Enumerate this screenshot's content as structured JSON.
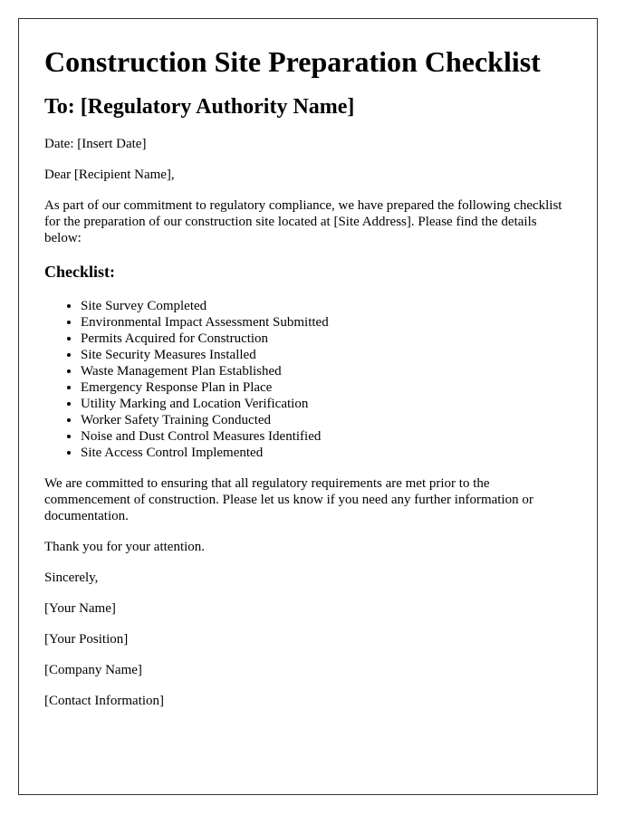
{
  "document": {
    "title": "Construction Site Preparation Checklist",
    "recipient_heading": "To: [Regulatory Authority Name]",
    "date_line": "Date: [Insert Date]",
    "salutation": "Dear [Recipient Name],",
    "intro_paragraph": "As part of our commitment to regulatory compliance, we have prepared the following checklist for the preparation of our construction site located at [Site Address]. Please find the details below:",
    "checklist_heading": "Checklist:",
    "checklist_items": [
      "Site Survey Completed",
      "Environmental Impact Assessment Submitted",
      "Permits Acquired for Construction",
      "Site Security Measures Installed",
      "Waste Management Plan Established",
      "Emergency Response Plan in Place",
      "Utility Marking and Location Verification",
      "Worker Safety Training Conducted",
      "Noise and Dust Control Measures Identified",
      "Site Access Control Implemented"
    ],
    "closing_paragraph": "We are committed to ensuring that all regulatory requirements are met prior to the commencement of construction. Please let us know if you need any further information or documentation.",
    "thanks_line": "Thank you for your attention.",
    "signoff": "Sincerely,",
    "signature": {
      "name": "[Your Name]",
      "position": "[Your Position]",
      "company": "[Company Name]",
      "contact": "[Contact Information]"
    }
  }
}
